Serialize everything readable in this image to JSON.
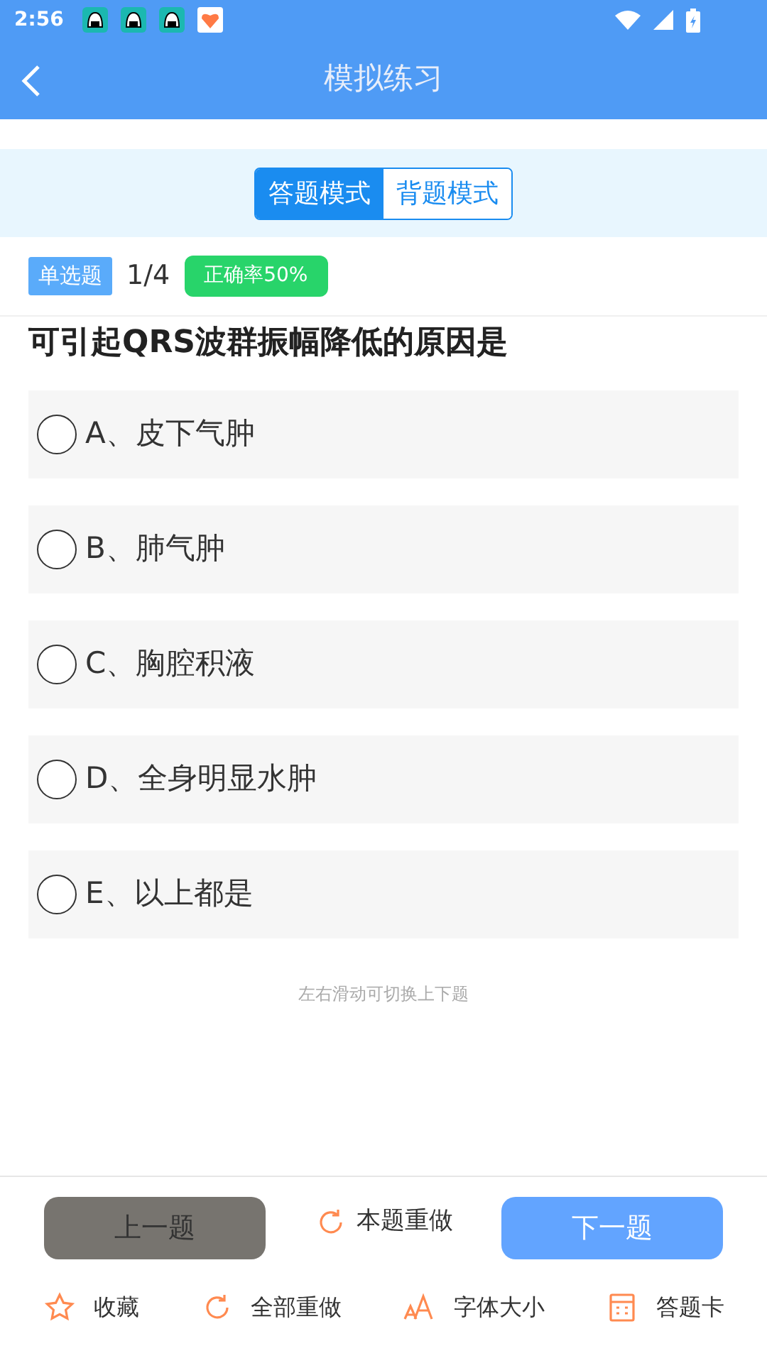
{
  "status_bar": {
    "time": "2:56"
  },
  "header": {
    "title": "模拟练习"
  },
  "mode_tabs": [
    {
      "label": "答题模式",
      "selected": true
    },
    {
      "label": "背题模式",
      "selected": false
    }
  ],
  "question": {
    "type_badge": "单选题",
    "progress": "1/4",
    "accuracy_badge": "正确率50%",
    "text": "可引起QRS波群振幅降低的原因是"
  },
  "options": [
    {
      "label": "A、皮下气肿",
      "selected": false
    },
    {
      "label": "B、肺气肿",
      "selected": false
    },
    {
      "label": "C、胸腔积液",
      "selected": false
    },
    {
      "label": "D、全身明显水肿",
      "selected": false
    },
    {
      "label": "E、以上都是",
      "selected": false
    }
  ],
  "hint": "左右滑动可切换上下题",
  "nav": {
    "previous": "上一题",
    "redo": "本题重做",
    "next": "下一题"
  },
  "toolbar": [
    {
      "kind": "star",
      "label": "收藏"
    },
    {
      "kind": "redo",
      "label": "全部重做"
    },
    {
      "kind": "font",
      "label": "字体大小"
    },
    {
      "kind": "card",
      "label": "答题卡"
    }
  ]
}
